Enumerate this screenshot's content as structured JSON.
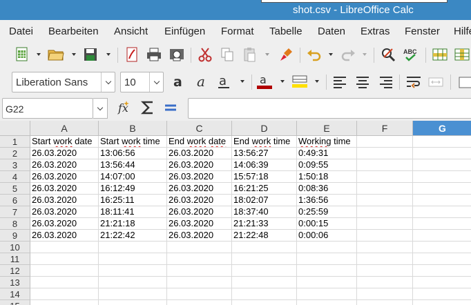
{
  "window": {
    "title": "shot.csv - LibreOffice Calc"
  },
  "menu": [
    "Datei",
    "Bearbeiten",
    "Ansicht",
    "Einfügen",
    "Format",
    "Tabelle",
    "Daten",
    "Extras",
    "Fenster",
    "Hilfe"
  ],
  "toolbar_standard": [
    "new-spreadsheet-icon",
    "open-folder-icon",
    "save-icon",
    "export-pdf-icon",
    "print-icon",
    "print-preview-icon",
    "cut-icon",
    "copy-icon",
    "paste-icon",
    "clone-formatting-icon",
    "undo-icon",
    "redo-icon",
    "find-replace-icon",
    "spelling-icon",
    "row-icon",
    "column-icon"
  ],
  "formatting": {
    "font_name": "Liberation Sans",
    "font_size": "10",
    "font_color": "#b00000",
    "highlight_color": "#ffe000"
  },
  "formula_bar": {
    "cell_ref": "G22",
    "formula": ""
  },
  "sheet": {
    "columns": [
      "A",
      "B",
      "C",
      "D",
      "E",
      "F",
      "G"
    ],
    "selected_column": "G",
    "row_numbers": [
      "1",
      "2",
      "3",
      "4",
      "5",
      "6",
      "7",
      "8",
      "9",
      "10",
      "11",
      "12",
      "13",
      "14",
      "15"
    ],
    "rows": [
      [
        "Start work date",
        "Start work time",
        "End work date",
        "End work time",
        "Working time"
      ],
      [
        "26.03.2020",
        "13:06:56",
        "26.03.2020",
        "13:56:27",
        "0:49:31"
      ],
      [
        "26.03.2020",
        "13:56:44",
        "26.03.2020",
        "14:06:39",
        "0:09:55"
      ],
      [
        "26.03.2020",
        "14:07:00",
        "26.03.2020",
        "15:57:18",
        "1:50:18"
      ],
      [
        "26.03.2020",
        "16:12:49",
        "26.03.2020",
        "16:21:25",
        "0:08:36"
      ],
      [
        "26.03.2020",
        "16:25:11",
        "26.03.2020",
        "18:02:07",
        "1:36:56"
      ],
      [
        "26.03.2020",
        "18:11:41",
        "26.03.2020",
        "18:37:40",
        "0:25:59"
      ],
      [
        "26.03.2020",
        "21:21:18",
        "26.03.2020",
        "21:21:33",
        "0:00:15"
      ],
      [
        "26.03.2020",
        "21:22:42",
        "26.03.2020",
        "21:22:48",
        "0:00:06"
      ]
    ]
  }
}
